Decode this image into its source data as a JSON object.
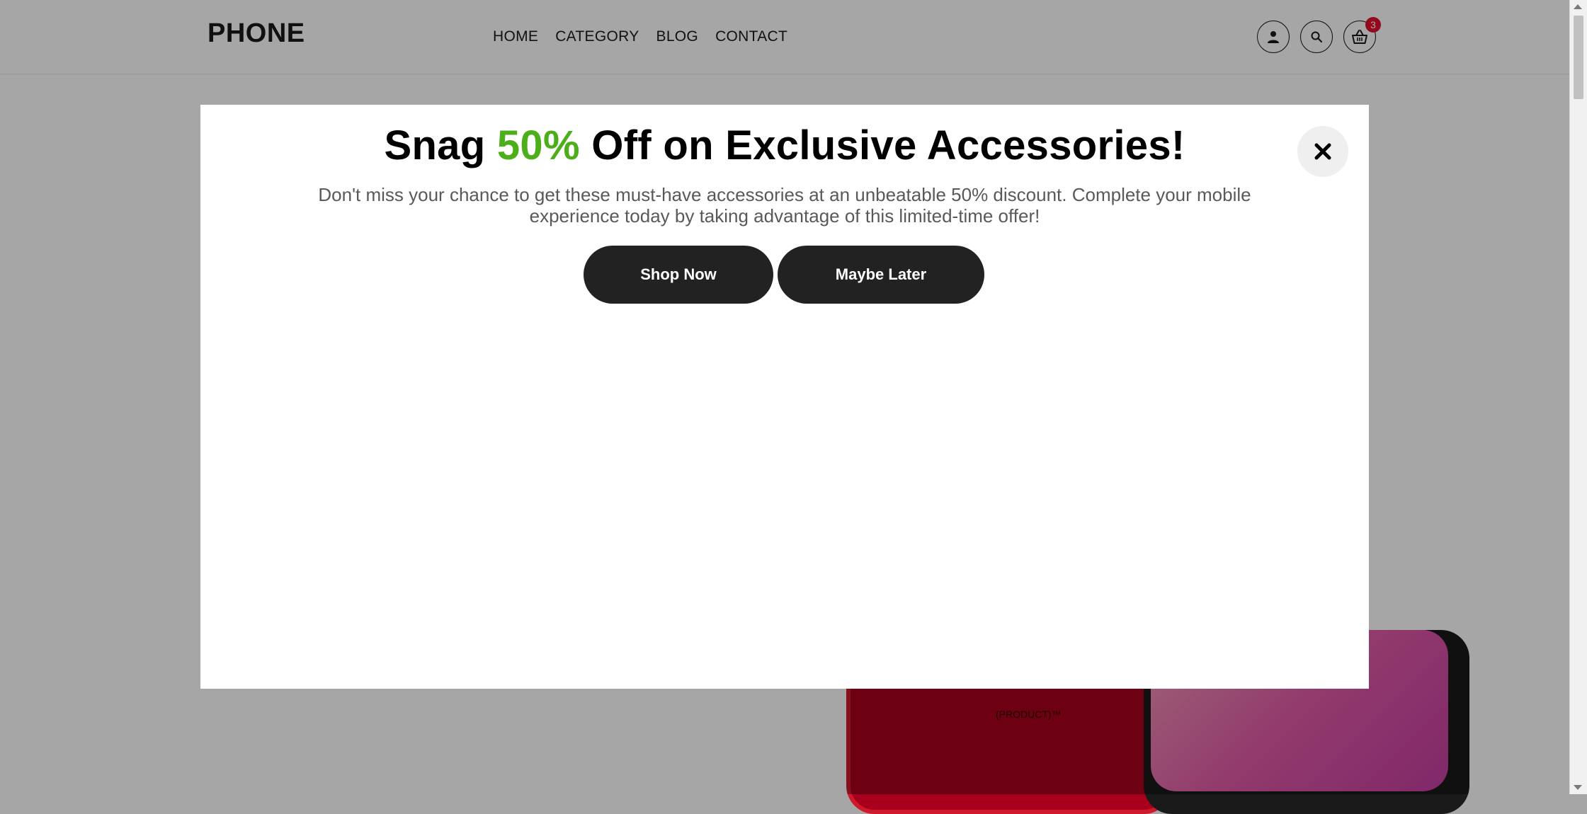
{
  "header": {
    "logo": "PHONE",
    "nav": [
      "HOME",
      "CATEGORY",
      "BLOG",
      "CONTACT"
    ],
    "cart_count": "3",
    "icons": [
      "user-icon",
      "search-icon",
      "basket-icon"
    ]
  },
  "product": {
    "mark": "(PRODUCT)™"
  },
  "modal": {
    "title_pre": "Snag ",
    "title_highlight": "50%",
    "title_post": " Off on Exclusive Accessories!",
    "description": "Don't miss your chance to get these must-have accessories at an unbeatable 50% discount. Complete your mobile experience today by taking advantage of this limited-time offer!",
    "primary_button": "Shop Now",
    "secondary_button": "Maybe Later",
    "close_icon": "close-icon",
    "highlight_color": "#4caf1a"
  }
}
